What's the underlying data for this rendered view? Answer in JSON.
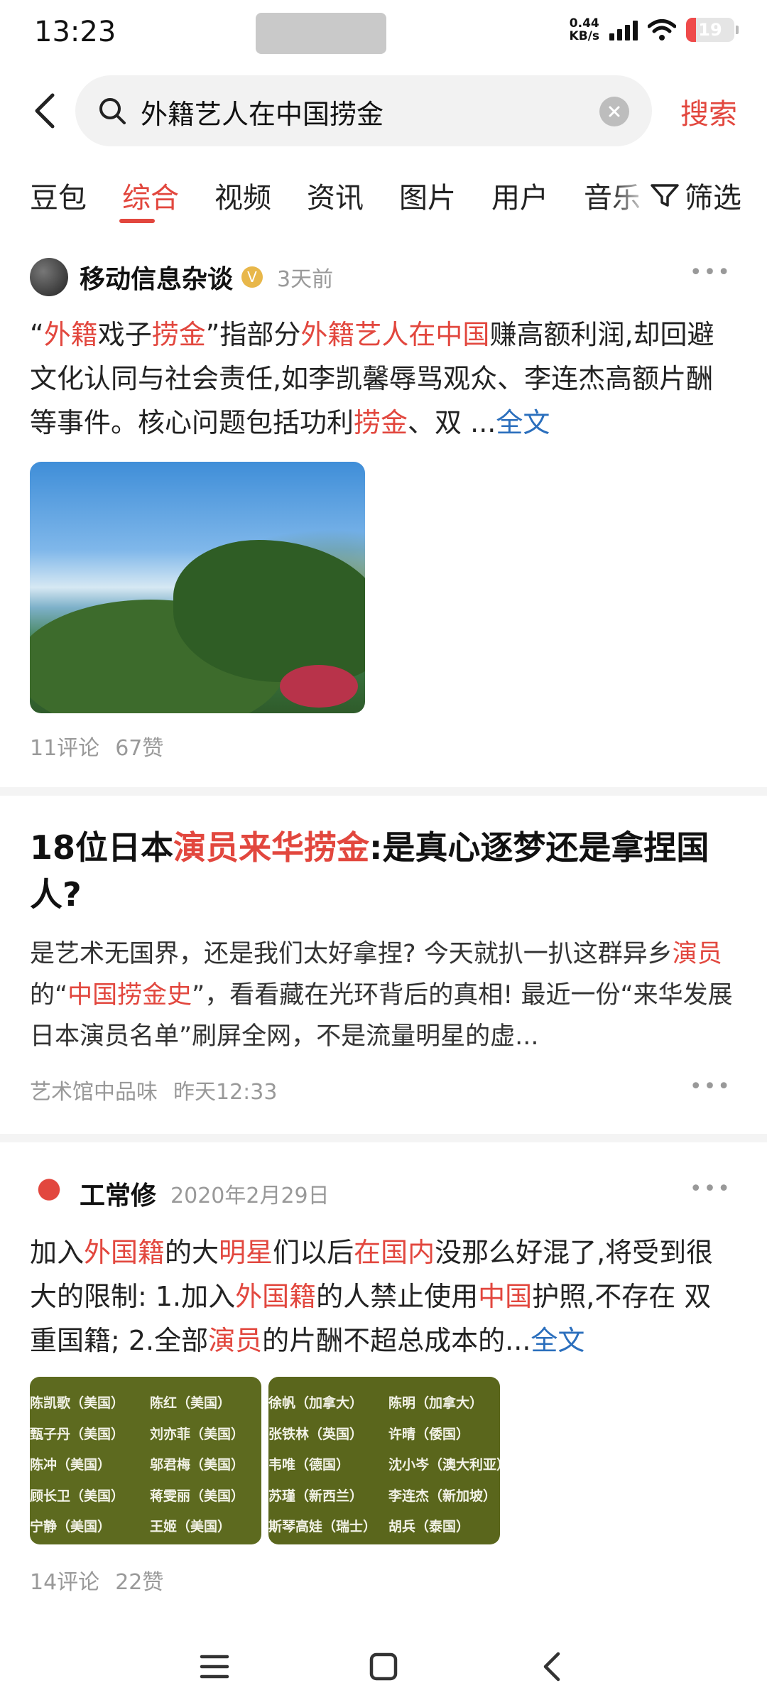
{
  "status_bar": {
    "time": "13:23",
    "net_speed_value": "0.44",
    "net_speed_unit": "KB/s",
    "battery": "19"
  },
  "search": {
    "query": "外籍艺人在中国捞金",
    "button": "搜索"
  },
  "tabs": {
    "items": [
      "豆包",
      "综合",
      "视频",
      "资讯",
      "图片",
      "用户",
      "音乐"
    ],
    "active": "综合",
    "filter": "筛选"
  },
  "posts": [
    {
      "author": "移动信息杂谈",
      "time": "3天前",
      "full_link": "全文",
      "comments": "11评论",
      "likes": "67赞"
    },
    {
      "title_a": "18位日本",
      "title_hl": "演员来华捞金",
      "title_b": ":是真心逐梦还是拿捏国人?",
      "source": "艺术馆中品味",
      "time": "昨天12:33"
    },
    {
      "author": "工常修",
      "time": "2020年2月29日",
      "full_link": "全文",
      "comments": "14评论",
      "likes": "22赞",
      "images": [
        [
          "陈凯歌（美国）",
          "陈红（美国）",
          "甄子丹（美国）",
          "刘亦菲（美国）",
          "陈冲（美国）",
          "邬君梅（美国）",
          "顾长卫（美国）",
          "蒋雯丽（美国）",
          "宁静（美国）",
          "王姬（美国）"
        ],
        [
          "徐帆（加拿大）",
          "陈明（加拿大）",
          "张铁林（英国）",
          "许晴（倭国）",
          "韦唯（德国）",
          "沈小岑（澳大利亚）",
          "苏瑾（新西兰）",
          "李连杰（新加坡）",
          "斯琴高娃（瑞士）",
          "胡兵（泰国）"
        ]
      ]
    }
  ],
  "p1": {
    "q1": "“",
    "h1": "外籍",
    "t1": "戏子",
    "h2": "捞金",
    "t2": "”指部分",
    "h3": "外籍艺人在中国",
    "t3": "赚高额利润,却回避文化认同与社会责任,如李凯馨辱骂观众、李连杰高额片酬等事件。核心问题包括功利",
    "h4": "捞金",
    "t4": "、双 ..."
  },
  "p2": {
    "t1": "是艺术无国界，还是我们太好拿捏? 今天就扒一扒这群异乡",
    "h1": "演员",
    "t2": "的“",
    "h2": "中国捞金史",
    "t3": "”，看看藏在光环背后的真相! 最近一份“来华发展日本演员名单”刷屏全网，不是流量明星的虚..."
  },
  "p3": {
    "t1": "加入",
    "h1": "外国籍",
    "t2": "的大",
    "h2": "明星",
    "t3": "们以后",
    "h3": "在国内",
    "t4": "没那么好混了,将受到很大的限制: 1.加入",
    "h4": "外国籍",
    "t5": "的人禁止使用",
    "h5": "中国",
    "t6": "护照,不存在 双重国籍; 2.全部",
    "h6": "演员",
    "t7": "的片酬不超总成本的..."
  },
  "colors": {
    "accent": "#e2473e",
    "link": "#2b6fbd",
    "meta": "#999999"
  }
}
